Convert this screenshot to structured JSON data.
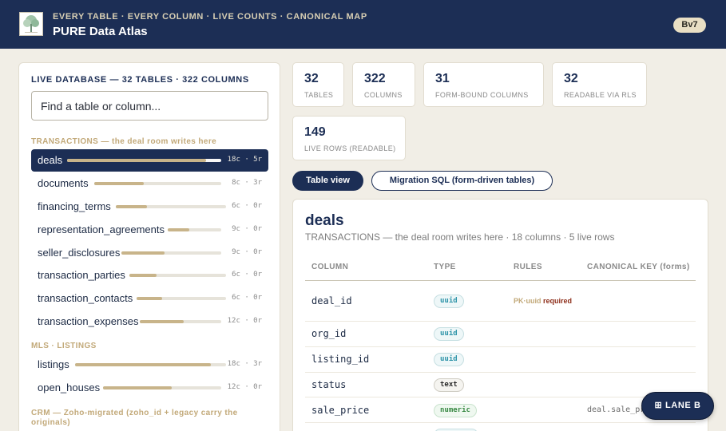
{
  "header": {
    "eyebrow": "EVERY TABLE · EVERY COLUMN · LIVE COUNTS · CANONICAL MAP",
    "title": "PURE Data Atlas",
    "version": "Bv7",
    "logo_icon": "tree-logo-icon"
  },
  "sidebar": {
    "title": "LIVE DATABASE — 32 TABLES · 322 COLUMNS",
    "search_placeholder": "Find a table or column...",
    "groups": [
      {
        "label": "TRANSACTIONS — the deal room writes here",
        "tables": [
          {
            "name": "deals",
            "meta": "18c · 5r",
            "fill": 0.9,
            "active": true
          },
          {
            "name": "documents",
            "meta": "8c · 3r",
            "fill": 0.39
          },
          {
            "name": "financing_terms",
            "meta": "6c · 0r",
            "fill": 0.28
          },
          {
            "name": "representation_agreements",
            "meta": "9c · 0r",
            "fill": 0.41
          },
          {
            "name": "seller_disclosures",
            "meta": "9c · 0r",
            "fill": 0.43
          },
          {
            "name": "transaction_parties",
            "meta": "6c · 0r",
            "fill": 0.28
          },
          {
            "name": "transaction_contacts",
            "meta": "6c · 0r",
            "fill": 0.29
          },
          {
            "name": "transaction_expenses",
            "meta": "12c · 0r",
            "fill": 0.54
          }
        ]
      },
      {
        "label": "MLS · LISTINGS",
        "tables": [
          {
            "name": "listings",
            "meta": "18c · 3r",
            "fill": 0.9
          },
          {
            "name": "open_houses",
            "meta": "12c · 0r",
            "fill": 0.58
          }
        ]
      },
      {
        "label": "CRM — Zoho-migrated (zoho_id + legacy carry the originals)",
        "tables": []
      }
    ]
  },
  "stats": [
    {
      "value": "32",
      "label": "TABLES"
    },
    {
      "value": "322",
      "label": "COLUMNS"
    },
    {
      "value": "31",
      "label": "FORM-BOUND COLUMNS"
    },
    {
      "value": "32",
      "label": "READABLE VIA RLS"
    },
    {
      "value": "149",
      "label": "LIVE ROWS (READABLE)"
    }
  ],
  "tabs": {
    "table_view": "Table view",
    "migration_sql": "Migration SQL (form-driven tables)"
  },
  "detail": {
    "title": "deals",
    "subtitle": "TRANSACTIONS — the deal room writes here · 18 columns · 5 live rows",
    "headers": [
      "COLUMN",
      "TYPE",
      "RULES",
      "CANONICAL KEY (forms)"
    ],
    "rows": [
      {
        "column": "deal_id",
        "type": "uuid",
        "rule_pk": "PK·uuid",
        "rule_req": "required",
        "canon": ""
      },
      {
        "column": "org_id",
        "type": "uuid",
        "rule_pk": "",
        "rule_req": "",
        "canon": ""
      },
      {
        "column": "listing_id",
        "type": "uuid",
        "rule_pk": "",
        "rule_req": "",
        "canon": ""
      },
      {
        "column": "status",
        "type": "text",
        "rule_pk": "",
        "rule_req": "",
        "canon": ""
      },
      {
        "column": "sale_price",
        "type": "numeric",
        "rule_pk": "",
        "rule_req": "",
        "canon": "deal.sale_price"
      },
      {
        "column": "",
        "type": "",
        "rule_pk": "",
        "rule_req": "",
        "canon": ""
      }
    ]
  },
  "lane": {
    "label": "LANE B",
    "icon": "grid-icon"
  }
}
